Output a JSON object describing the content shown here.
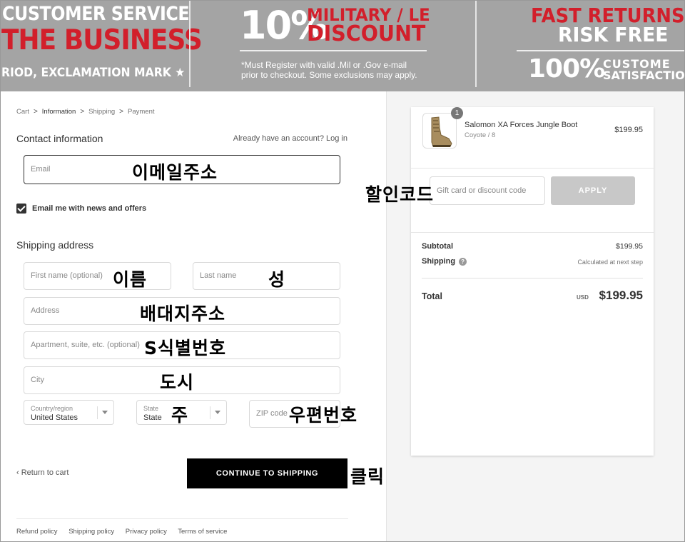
{
  "banner": {
    "panel1_line1": "CUSTOMER SERVICE",
    "panel1_line2": "THE BUSINESS",
    "panel1_line3": "RIOD, EXCLAMATION MARK ★",
    "panel2_percent": "10%",
    "panel2_line1": "MILITARY / LE",
    "panel2_line2": "DISCOUNT",
    "panel2_note1": "*Must Register with valid .Mil or .Gov e-mail",
    "panel2_note2": "prior to checkout. Some exclusions may apply.",
    "panel3_line1": "FAST RETURNS",
    "panel3_line2": "RISK FREE",
    "panel3_percent": "100%",
    "panel3_line3": "CUSTOME",
    "panel3_line4": "SATISFACTIO"
  },
  "breadcrumb": {
    "cart": "Cart",
    "information": "Information",
    "shipping": "Shipping",
    "payment": "Payment"
  },
  "contact": {
    "heading": "Contact information",
    "login_prompt": "Already have an account? Log in",
    "email_placeholder": "Email",
    "newsletter_label": "Email me with news and offers"
  },
  "shipping": {
    "heading": "Shipping address",
    "first_name_placeholder": "First name (optional)",
    "last_name_placeholder": "Last name",
    "address_placeholder": "Address",
    "apartment_placeholder": "Apartment, suite, etc. (optional)",
    "city_placeholder": "City",
    "country_label": "Country/region",
    "country_value": "United States",
    "state_label": "State",
    "state_value": "State",
    "zip_placeholder": "ZIP code"
  },
  "actions": {
    "return_to_cart": "Return to cart",
    "continue_label": "CONTINUE TO SHIPPING"
  },
  "footer": {
    "links": [
      "Refund policy",
      "Shipping policy",
      "Privacy policy",
      "Terms of service"
    ]
  },
  "summary": {
    "item": {
      "quantity": "1",
      "name": "Salomon XA Forces Jungle Boot",
      "variant": "Coyote / 8",
      "price": "$199.95"
    },
    "discount_placeholder": "Gift card or discount code",
    "apply_label": "APPLY",
    "subtotal_label": "Subtotal",
    "subtotal_value": "$199.95",
    "shipping_label": "Shipping",
    "shipping_value": "Calculated at next step",
    "total_label": "Total",
    "currency": "USD",
    "total_value": "$199.95"
  },
  "annotations": {
    "email": "이메일주소",
    "discount": "할인코드",
    "first_name": "이름",
    "last_name": "성",
    "address": "배대지주소",
    "apartment": "S식별번호",
    "city": "도시",
    "state": "주",
    "zip": "우편번호",
    "click": "클릭"
  },
  "colors": {
    "banner_bg": "#a4a4a4",
    "banner_red": "#d21f2b",
    "primary_button": "#000000",
    "apply_button": "#c8c8c8"
  }
}
